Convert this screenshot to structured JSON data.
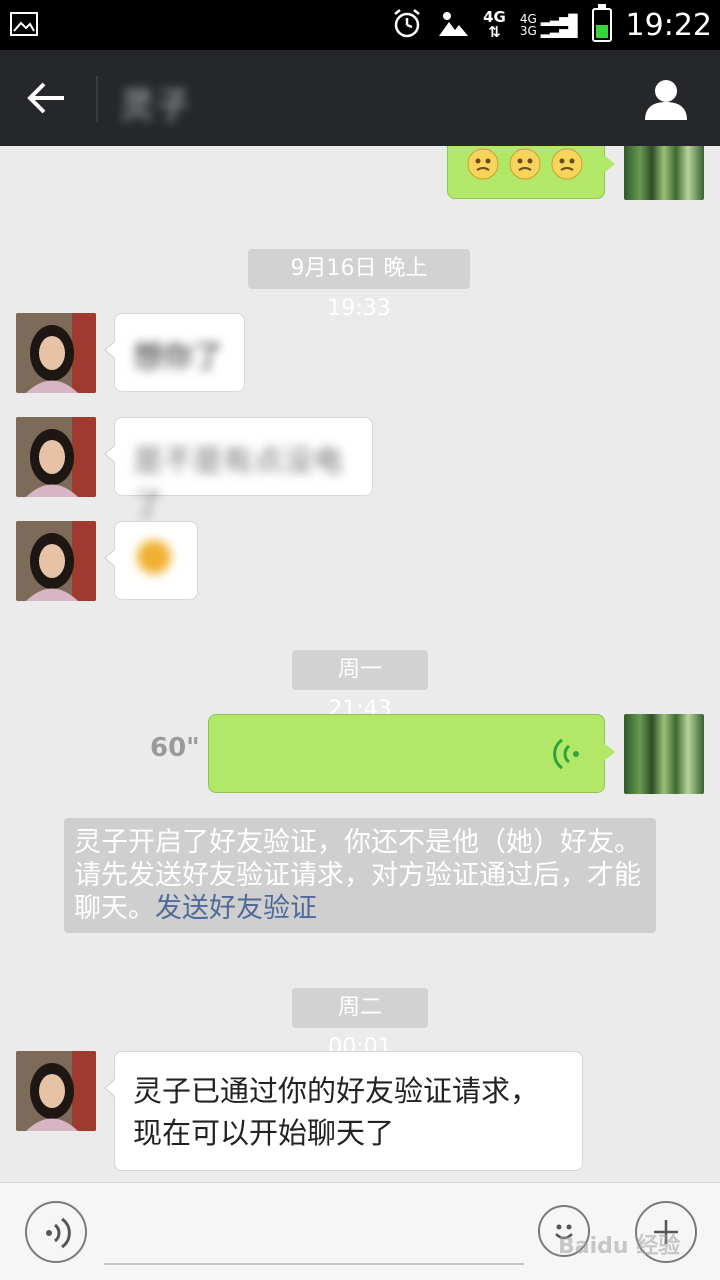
{
  "status_bar": {
    "clock": "19:22",
    "network_4g": "4G",
    "signal_4g": "4G",
    "signal_3g": "3G",
    "icons": [
      "gallery-icon",
      "alarm-icon",
      "weather-icon",
      "data-arrows-icon",
      "battery-icon"
    ],
    "battery_level": 0.45
  },
  "header": {
    "title": "灵子",
    "back_icon": "arrow-left-icon",
    "profile_icon": "person-icon"
  },
  "chat": {
    "emoji_count": 3,
    "timestamps": [
      "9月16日 晚上19:33",
      "周一 21:43",
      "周二 00:01"
    ],
    "incoming_blurred": [
      "想你了",
      "是不是有点没电了"
    ],
    "voice_duration": "60\"",
    "system_notice": "灵子开启了好友验证，你还不是他（她）好友。请先发送好友验证请求，对方验证通过后，才能聊天。",
    "system_link": "发送好友验证",
    "last_message": "灵子已通过你的好友验证请求，现在可以开始聊天了"
  },
  "input_bar": {
    "voice_icon": "voice-mode-icon",
    "emoji_icon": "emoji-icon",
    "plus_icon": "plus-icon",
    "watermark": "Baidu 经验"
  },
  "colors": {
    "title_bar": "#25272b",
    "chat_bg": "#ebebeb",
    "outgoing_bubble": "#b2e768",
    "timestamp_pill": "#d2d2d2",
    "link": "#4f6a9a"
  }
}
